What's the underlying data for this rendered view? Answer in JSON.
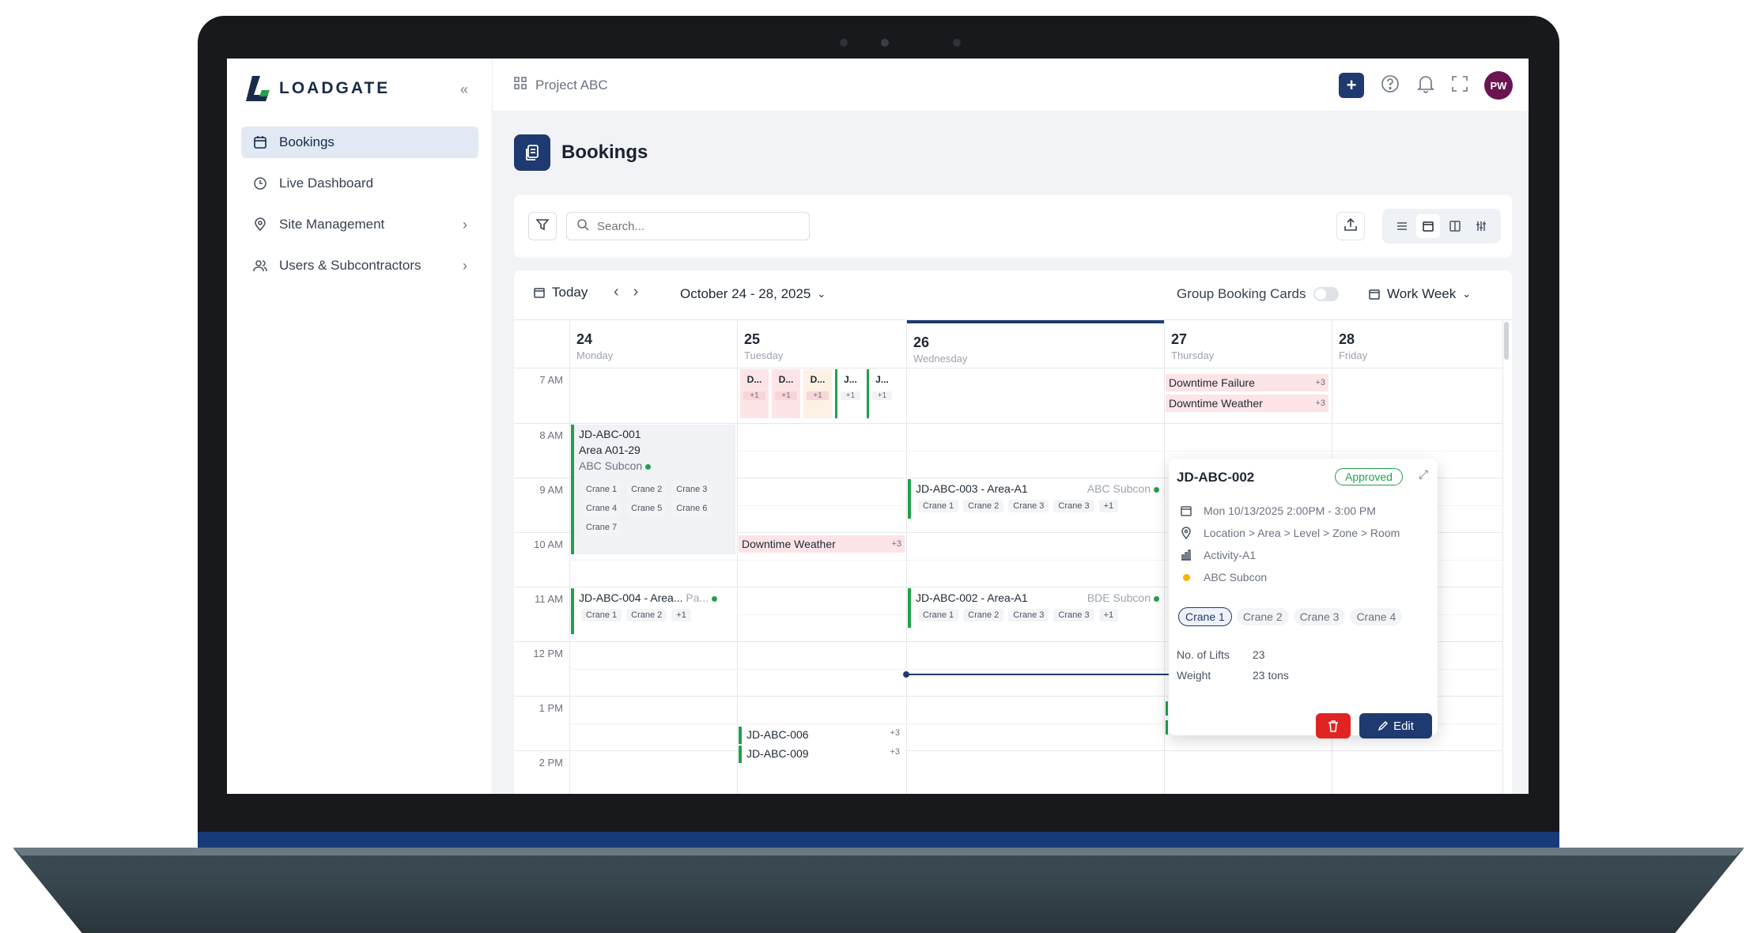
{
  "app": {
    "name": "LOADGATE",
    "collapse_label": "«"
  },
  "sidebar": {
    "items": [
      {
        "label": "Bookings",
        "active": true,
        "icon": "calendar-icon"
      },
      {
        "label": "Live Dashboard",
        "icon": "clock-icon"
      },
      {
        "label": "Site Management",
        "icon": "pin-icon",
        "has_children": true
      },
      {
        "label": "Users & Subcontractors",
        "icon": "users-icon",
        "has_children": true
      }
    ]
  },
  "topbar": {
    "project": "Project ABC",
    "avatar_initials": "PW"
  },
  "page": {
    "title": "Bookings"
  },
  "toolbar": {
    "search_placeholder": "Search..."
  },
  "calendar": {
    "today_label": "Today",
    "range": "October 24 - 28, 2025",
    "group_label": "Group Booking Cards",
    "view_label": "Work Week",
    "days": [
      {
        "num": "24",
        "name": "Monday"
      },
      {
        "num": "25",
        "name": "Tuesday"
      },
      {
        "num": "26",
        "name": "Wednesday"
      },
      {
        "num": "27",
        "name": "Thursday"
      },
      {
        "num": "28",
        "name": "Friday"
      }
    ],
    "times": [
      "7 AM",
      "8 AM",
      "9 AM",
      "10 AM",
      "11 AM",
      "12 PM",
      "1 PM",
      "2 PM"
    ],
    "events": {
      "mon_booking": {
        "id": "JD-ABC-001",
        "area": "Area A01-29",
        "sub": "ABC Subcon",
        "chips": [
          "Crane 1",
          "Crane 2",
          "Crane 3",
          "Crane 4",
          "Crane 5",
          "Crane 6",
          "Crane 7"
        ]
      },
      "mon_booking2": {
        "title": "JD-ABC-004 - Area...",
        "tag": "Pa...",
        "chips": [
          "Crane 1",
          "Crane 2",
          "+1"
        ]
      },
      "tue_minis": [
        {
          "label": "D...",
          "more": "+1"
        },
        {
          "label": "D...",
          "more": "+1"
        },
        {
          "label": "D...",
          "more": "+1"
        },
        {
          "label": "J...",
          "more": "+1"
        },
        {
          "label": "J...",
          "more": "+1"
        }
      ],
      "tue_downtime": {
        "label": "Downtime Weather",
        "more": "+3"
      },
      "tue_b6": {
        "label": "JD-ABC-006",
        "more": "+3"
      },
      "tue_b9": {
        "label": "JD-ABC-009",
        "more": "+3"
      },
      "wed_b3": {
        "title": "JD-ABC-003 - Area-A1",
        "sub": "ABC Subcon",
        "chips": [
          "Crane 1",
          "Crane 2",
          "Crane 3",
          "Crane 3",
          "+1"
        ]
      },
      "wed_b2": {
        "title": "JD-ABC-002 - Area-A1",
        "sub": "BDE Subcon",
        "chips": [
          "Crane 1",
          "Crane 2",
          "Crane 3",
          "Crane 3",
          "+1"
        ]
      },
      "thu_dt1": {
        "label": "Downtime Failure",
        "more": "+3"
      },
      "thu_dt2": {
        "label": "Downtime Weather",
        "more": "+3"
      }
    }
  },
  "popover": {
    "title": "JD-ABC-002",
    "status": "Approved",
    "datetime": "Mon 10/13/2025 2:00PM - 3:00 PM",
    "location": "Location > Area > Level > Zone > Room",
    "activity": "Activity-A1",
    "subcontractor": "ABC Subcon",
    "cranes": [
      "Crane 1",
      "Crane 2",
      "Crane 3",
      "Crane 4"
    ],
    "lifts_label": "No. of Lifts",
    "lifts_value": "23",
    "weight_label": "Weight",
    "weight_value": "23 tons",
    "edit_label": "Edit"
  },
  "colors": {
    "brand": "#1e3a70",
    "green": "#22a04b",
    "danger": "#e02424",
    "downtime": "#fde4e6",
    "avatar": "#6b1452"
  }
}
